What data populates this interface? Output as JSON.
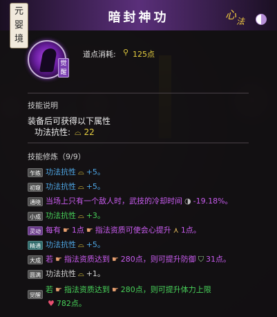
{
  "header": {
    "title": "暗封神功",
    "realm_tag": [
      "元",
      "婴",
      "境"
    ],
    "xinfa_logo": [
      "心",
      "法"
    ],
    "yinyang_icon": "yinyang-icon"
  },
  "skill": {
    "icon": "shadow-figure-icon",
    "badge": "觉醒",
    "cost_label": "道点消耗:",
    "cost_value": "125点"
  },
  "description": {
    "heading": "技能说明",
    "intro": "装备后可获得以下属性",
    "attr_label": "功法抗性:",
    "attr_value": "22"
  },
  "cultivation": {
    "heading": "技能修炼（9/9）",
    "rows": [
      {
        "tag": "乍练",
        "tag_color": "gray",
        "text": "功法抗性",
        "value": "+5。",
        "color": "c-blue"
      },
      {
        "tag": "初窥",
        "tag_color": "gray",
        "text": "功法抗性",
        "value": "+5。",
        "color": "c-blue"
      },
      {
        "tag": "通晓",
        "tag_color": "gray",
        "text": "当场上只有一个敌人时，武技的冷却时间",
        "value": "-19.18%。",
        "color": "c-purple"
      },
      {
        "tag": "小成",
        "tag_color": "gray",
        "text": "功法抗性",
        "value": "+3。",
        "color": "c-green"
      },
      {
        "tag": "灵动",
        "tag_color": "purple",
        "pre": "每有",
        "mid1": "1点",
        "mid2": "指法资质可使会心提升",
        "value": "1点。",
        "color": "c-purple"
      },
      {
        "tag": "精通",
        "tag_color": "teal",
        "text": "功法抗性",
        "value": "+5。",
        "color": "c-blue"
      },
      {
        "tag": "大成",
        "tag_color": "gray",
        "pre": "若",
        "mid1": "指法资质达到",
        "mid2": "280点，则可提升防御",
        "value": "31点。",
        "color": "c-purple"
      },
      {
        "tag": "圆满",
        "tag_color": "gray",
        "text": "功法抗性",
        "value": "+1。",
        "color": "c-white"
      },
      {
        "tag": "觉醒",
        "tag_color": "gray",
        "pre": "若",
        "mid1": "指法资质达到",
        "mid2": "280点，则可提升体力上限",
        "value": "782点。",
        "color": "c-green"
      }
    ]
  }
}
